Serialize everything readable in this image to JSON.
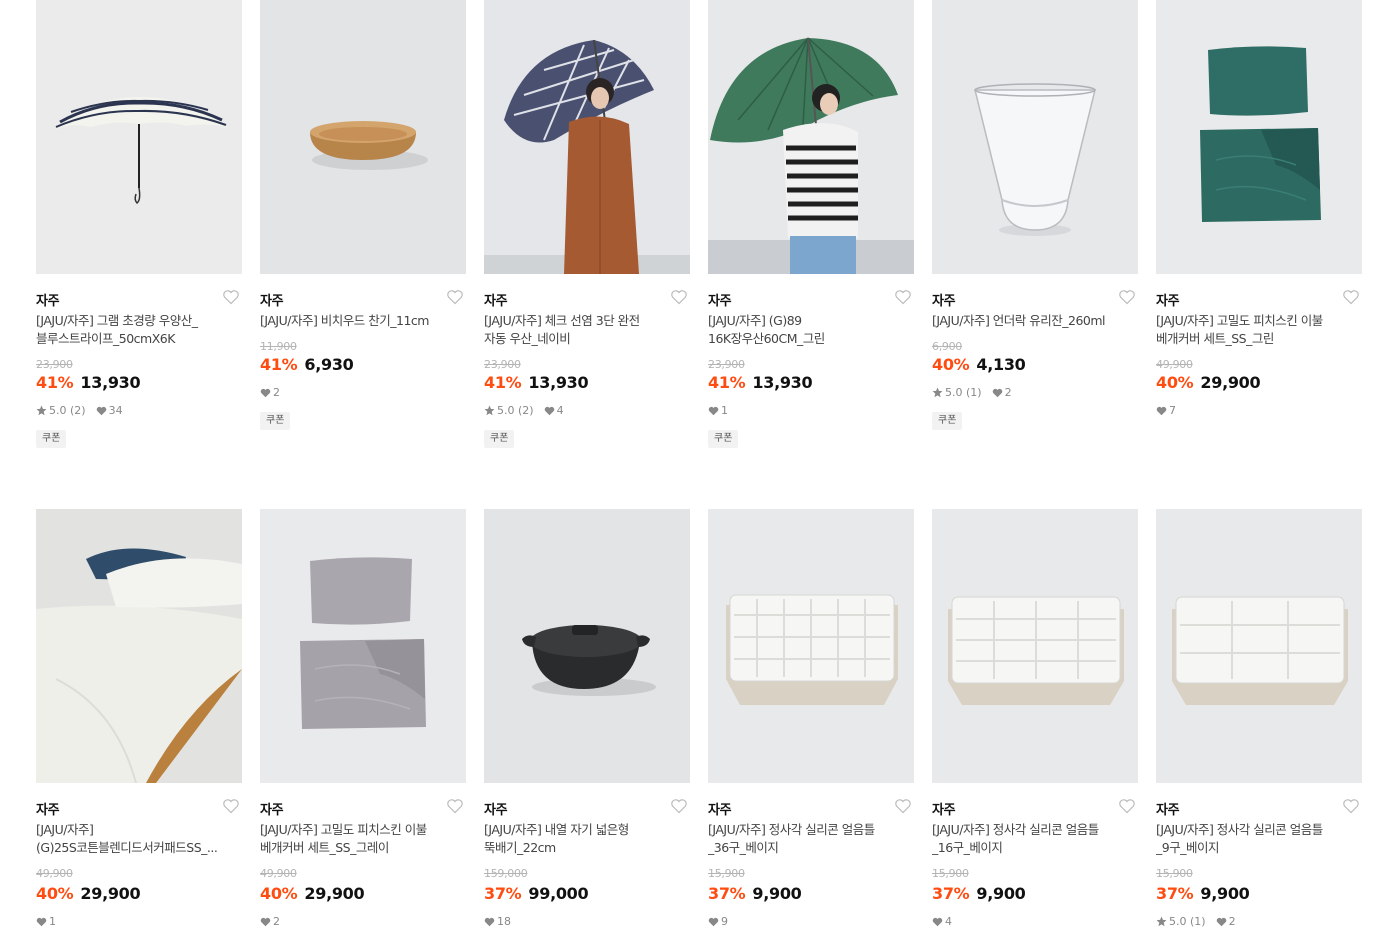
{
  "colors": {
    "discount": "#ff4d12",
    "text": "#111111",
    "muted": "#888888",
    "strike": "#b4b4b4"
  },
  "products": [
    {
      "brand": "자주",
      "name": "[JAJU/자주] 그램 초경량 우양산_\n블루스트라이프_50cmX6K",
      "original_price": "23,900",
      "discount": "41%",
      "price": "13,930",
      "rating": "5.0 (2)",
      "likes": "34",
      "coupon": "쿠폰",
      "image": "striped-umbrella"
    },
    {
      "brand": "자주",
      "name": "[JAJU/자주] 비치우드 찬기_11cm",
      "original_price": "11,900",
      "discount": "41%",
      "price": "6,930",
      "rating": null,
      "likes": "2",
      "coupon": "쿠폰",
      "image": "wood-bowl"
    },
    {
      "brand": "자주",
      "name": "[JAJU/자주] 체크 선염 3단 완전\n자동 우산_네이비",
      "original_price": "23,900",
      "discount": "41%",
      "price": "13,930",
      "rating": "5.0 (2)",
      "likes": "4",
      "coupon": "쿠폰",
      "image": "check-umbrella-model"
    },
    {
      "brand": "자주",
      "name": "[JAJU/자주] (G)89\n16K장우산60CM_그린",
      "original_price": "23,900",
      "discount": "41%",
      "price": "13,930",
      "rating": null,
      "likes": "1",
      "coupon": "쿠폰",
      "image": "green-umbrella-model"
    },
    {
      "brand": "자주",
      "name": "[JAJU/자주] 언더락 유리잔_260ml",
      "original_price": "6,900",
      "discount": "40%",
      "price": "4,130",
      "rating": "5.0 (1)",
      "likes": "2",
      "coupon": "쿠폰",
      "image": "rock-glass"
    },
    {
      "brand": "자주",
      "name": "[JAJU/자주] 고밀도 피치스킨 이불\n베개커버 세트_SS_그린",
      "original_price": "49,900",
      "discount": "40%",
      "price": "29,900",
      "rating": null,
      "likes": "7",
      "coupon": null,
      "image": "green-bedding"
    },
    {
      "brand": "자주",
      "name": "[JAJU/자주]\n(G)25S코튼블렌디드서커패드SS_...",
      "original_price": "49,900",
      "discount": "40%",
      "price": "29,900",
      "rating": null,
      "likes": "1",
      "coupon": null,
      "image": "white-bed"
    },
    {
      "brand": "자주",
      "name": "[JAJU/자주] 고밀도 피치스킨 이불\n베개커버 세트_SS_그레이",
      "original_price": "49,900",
      "discount": "40%",
      "price": "29,900",
      "rating": null,
      "likes": "2",
      "coupon": null,
      "image": "gray-bedding"
    },
    {
      "brand": "자주",
      "name": "[JAJU/자주] 내열 자기 넓은형\n뚝배기_22cm",
      "original_price": "159,000",
      "discount": "37%",
      "price": "99,000",
      "rating": null,
      "likes": "18",
      "coupon": null,
      "image": "black-pot"
    },
    {
      "brand": "자주",
      "name": "[JAJU/자주] 정사각 실리콘 얼음틀\n_36구_베이지",
      "original_price": "15,900",
      "discount": "37%",
      "price": "9,900",
      "rating": null,
      "likes": "9",
      "coupon": null,
      "image": "ice-tray-36"
    },
    {
      "brand": "자주",
      "name": "[JAJU/자주] 정사각 실리콘 얼음틀\n_16구_베이지",
      "original_price": "15,900",
      "discount": "37%",
      "price": "9,900",
      "rating": null,
      "likes": "4",
      "coupon": null,
      "image": "ice-tray-16"
    },
    {
      "brand": "자주",
      "name": "[JAJU/자주] 정사각 실리콘 얼음틀\n_9구_베이지",
      "original_price": "15,900",
      "discount": "37%",
      "price": "9,900",
      "rating": "5.0 (1)",
      "likes": "2",
      "coupon": null,
      "image": "ice-tray-9"
    }
  ]
}
